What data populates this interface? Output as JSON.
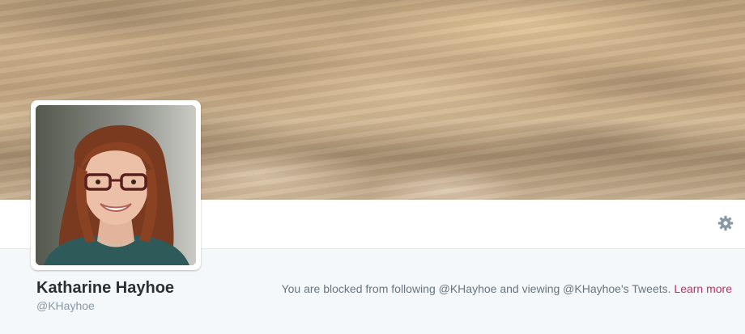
{
  "profile": {
    "name": "Katharine Hayhoe",
    "handle": "@KHayhoe"
  },
  "notice": {
    "text": "You are blocked from following @KHayhoe and viewing @KHayhoe's Tweets.",
    "link_label": "Learn more"
  },
  "icons": {
    "settings": "gear-icon"
  },
  "colors": {
    "link": "#c0325f",
    "background": "#f5f8fa",
    "name_text": "#292f33",
    "muted_text": "#8899a6"
  }
}
